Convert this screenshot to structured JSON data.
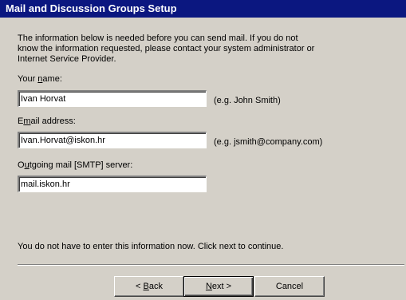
{
  "window": {
    "title": "Mail and Discussion Groups Setup"
  },
  "intro_text": "The information below is needed before you can send mail.  If you do not\nknow the information requested, please contact your system administrator or\nInternet Service Provider.",
  "fields": {
    "name": {
      "label_pre": "Your ",
      "label_key": "n",
      "label_post": "ame:",
      "value": "Ivan Horvat",
      "hint": "(e.g. John Smith)"
    },
    "email": {
      "label_pre": "E",
      "label_key": "m",
      "label_post": "ail address:",
      "value": "Ivan.Horvat@iskon.hr",
      "hint": "(e.g. jsmith@company.com)"
    },
    "smtp": {
      "label_pre": "O",
      "label_key": "u",
      "label_post": "tgoing mail [SMTP] server:",
      "value": "mail.iskon.hr"
    }
  },
  "footnote": "You do not have to enter this information now. Click next to continue.",
  "buttons": {
    "back_key": "B",
    "back_rest": "ack",
    "back_prefix": "< ",
    "next_key": "N",
    "next_rest": "ext",
    "next_suffix": " >",
    "cancel": "Cancel"
  }
}
